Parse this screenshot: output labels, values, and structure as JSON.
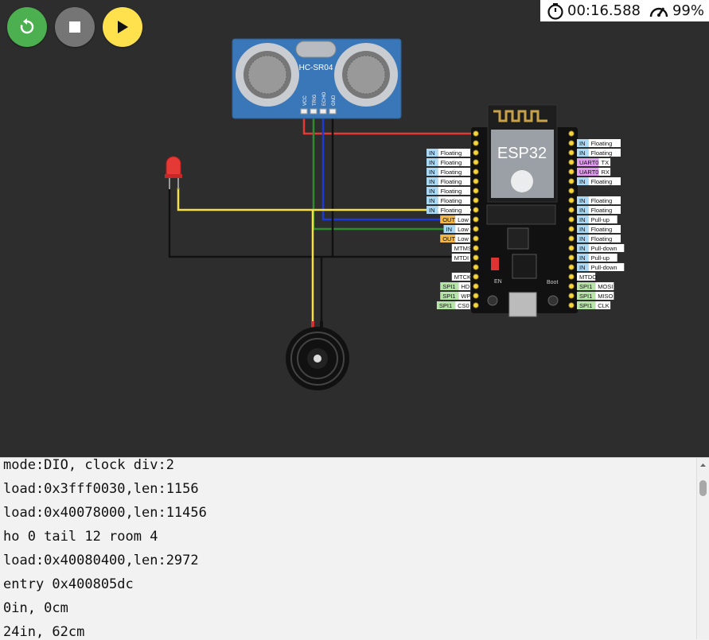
{
  "toolbar": {
    "restart_icon": "restart-icon",
    "stop_icon": "stop-icon",
    "play_icon": "play-icon",
    "colors": {
      "restart": "#4caf50",
      "stop": "#757575",
      "play": "#ffe14d"
    }
  },
  "status": {
    "timer": "00:16.588",
    "speed": "99%"
  },
  "sensor": {
    "label": "HC-SR04",
    "pins": [
      "VCC",
      "TRIG",
      "ECHO",
      "GND"
    ]
  },
  "board": {
    "label": "ESP32",
    "button_en": "EN",
    "button_boot": "Boot",
    "left_tags": [
      {
        "kind": "IN",
        "text": "Floating"
      },
      {
        "kind": "IN",
        "text": "Floating"
      },
      {
        "kind": "IN",
        "text": "Floating"
      },
      {
        "kind": "IN",
        "text": "Floating"
      },
      {
        "kind": "IN",
        "text": "Floating"
      },
      {
        "kind": "IN",
        "text": "Floating"
      },
      {
        "kind": "IN",
        "text": "Floating"
      },
      {
        "kind": "OUT",
        "text": "Low"
      },
      {
        "kind": "IN",
        "text": "Low"
      },
      {
        "kind": "OUT",
        "text": "Low"
      },
      {
        "kind": "",
        "text": "MTMS"
      },
      {
        "kind": "",
        "text": "MTDI"
      },
      {
        "kind": "",
        "text": ""
      },
      {
        "kind": "",
        "text": "MTCK"
      },
      {
        "kind": "SPI1",
        "text": "HD"
      },
      {
        "kind": "SPI1",
        "text": "WP"
      },
      {
        "kind": "SPI1",
        "text": "CS0"
      }
    ],
    "right_tags": [
      {
        "kind": "IN",
        "text": "Floating"
      },
      {
        "kind": "IN",
        "text": "Floating"
      },
      {
        "kind": "UART0",
        "text": "TX"
      },
      {
        "kind": "UART0",
        "text": "RX"
      },
      {
        "kind": "IN",
        "text": "Floating"
      },
      {
        "kind": "",
        "text": ""
      },
      {
        "kind": "IN",
        "text": "Floating"
      },
      {
        "kind": "IN",
        "text": "Floating"
      },
      {
        "kind": "IN",
        "text": "Pull-up"
      },
      {
        "kind": "IN",
        "text": "Floating"
      },
      {
        "kind": "IN",
        "text": "Floating"
      },
      {
        "kind": "IN",
        "text": "Pull-down"
      },
      {
        "kind": "IN",
        "text": "Pull-up"
      },
      {
        "kind": "IN",
        "text": "Pull-down"
      },
      {
        "kind": "",
        "text": "MTDO"
      },
      {
        "kind": "SPI1",
        "text": "MOSI"
      },
      {
        "kind": "SPI1",
        "text": "MISO"
      },
      {
        "kind": "SPI1",
        "text": "CLK"
      }
    ]
  },
  "console": {
    "lines": [
      "mode:DIO, clock div:2",
      "load:0x3fff0030,len:1156",
      "load:0x40078000,len:11456",
      "ho 0 tail 12 room 4",
      "load:0x40080400,len:2972",
      "entry 0x400805dc",
      "0in, 0cm",
      "24in, 62cm"
    ]
  }
}
